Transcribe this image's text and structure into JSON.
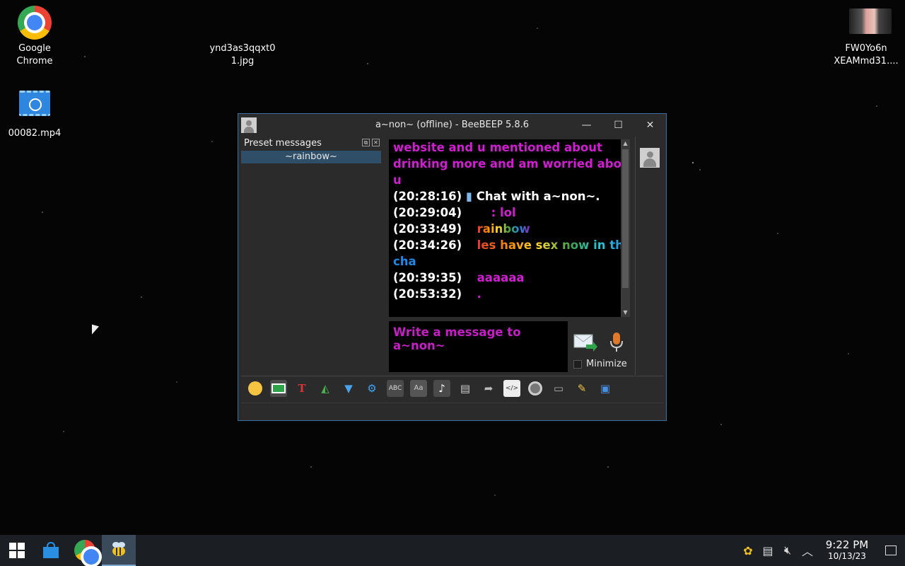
{
  "desktop": {
    "icons": [
      {
        "label": "Google\nChrome"
      },
      {
        "label": "ynd3as3qqxt0\n1.jpg"
      },
      {
        "label": "00082.mp4"
      },
      {
        "label": "FW0Yo6n\nXEAMmd31...."
      }
    ]
  },
  "window": {
    "title": "a~non~ (offline) - BeeBEEP 5.8.6",
    "controls": {
      "minimize": "—",
      "maximize": "☐",
      "close": "✕"
    },
    "preset": {
      "header": "Preset messages",
      "items": [
        "~rainbow~"
      ]
    },
    "chat": {
      "lines": [
        {
          "ts": "",
          "text": "website and u mentioned about"
        },
        {
          "ts": "",
          "text": "drinking more and am worried about"
        },
        {
          "ts": "",
          "text": "u"
        },
        {
          "ts": "(20:28:16)",
          "text": "Chat with a~non~."
        },
        {
          "ts": "(20:29:04)",
          "text": ": lol"
        },
        {
          "ts": "(20:33:49)",
          "text": "rainbow"
        },
        {
          "ts": "(20:34:26)",
          "text": "les have sex now in the"
        },
        {
          "ts": "",
          "text": "cha"
        },
        {
          "ts": "(20:39:35)",
          "text": "aaaaaa"
        },
        {
          "ts": "(20:53:32)",
          "text": "."
        }
      ]
    },
    "compose": {
      "placeholder": "Write a message to a~non~"
    },
    "minimize_label": "Minimize",
    "toolbar": [
      "smiley-icon",
      "mail-icon",
      "text-format-icon",
      "color-icon",
      "filter-icon",
      "settings-icon",
      "spellcheck-icon",
      "font-icon",
      "music-icon",
      "file-icon",
      "send-file-icon",
      "code-icon",
      "record-icon",
      "terminal-icon",
      "edit-icon",
      "save-icon"
    ]
  },
  "taskbar": {
    "time": "9:22 PM",
    "date": "10/13/23"
  },
  "colors": {
    "accent": "#3c6fa0",
    "selected": "#2f4e67",
    "magenta": "#d01fd0"
  }
}
